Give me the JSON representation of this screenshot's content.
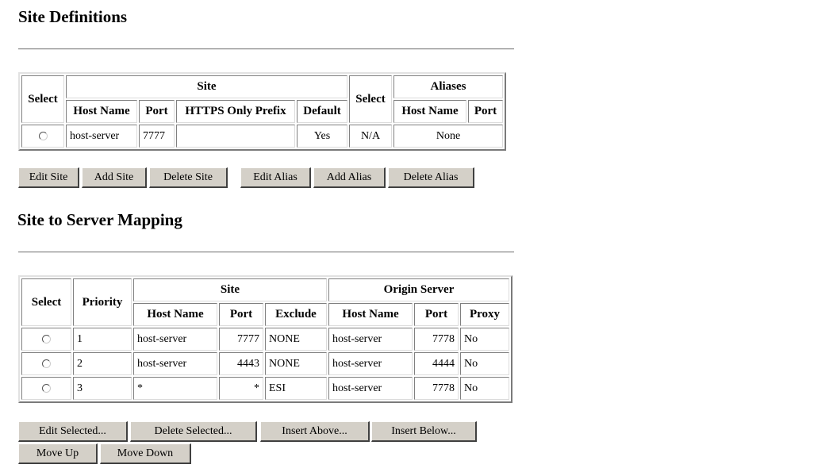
{
  "site_definitions": {
    "title": "Site Definitions",
    "headers": {
      "select": "Select",
      "site": "Site",
      "host_name": "Host Name",
      "port": "Port",
      "https_only_prefix": "HTTPS Only Prefix",
      "default": "Default",
      "select2": "Select",
      "aliases": "Aliases",
      "alias_host_name": "Host Name",
      "alias_port": "Port"
    },
    "rows": [
      {
        "host_name": "host-server",
        "port": "7777",
        "https_only_prefix": "",
        "default": "Yes",
        "alias_select": "N/A",
        "aliases": "None"
      }
    ],
    "buttons": {
      "edit_site": "Edit Site",
      "add_site": "Add Site",
      "delete_site": "Delete Site",
      "edit_alias": "Edit Alias",
      "add_alias": "Add Alias",
      "delete_alias": "Delete Alias"
    }
  },
  "mapping": {
    "title": "Site to Server Mapping",
    "headers": {
      "select": "Select",
      "priority": "Priority",
      "site": "Site",
      "origin_server": "Origin Server",
      "host_name": "Host Name",
      "port": "Port",
      "exclude": "Exclude",
      "origin_host_name": "Host Name",
      "origin_port": "Port",
      "proxy": "Proxy"
    },
    "rows": [
      {
        "priority": "1",
        "host_name": "host-server",
        "port": "7777",
        "exclude": "NONE",
        "origin_host": "host-server",
        "origin_port": "7778",
        "proxy": "No"
      },
      {
        "priority": "2",
        "host_name": "host-server",
        "port": "4443",
        "exclude": "NONE",
        "origin_host": "host-server",
        "origin_port": "4444",
        "proxy": "No"
      },
      {
        "priority": "3",
        "host_name": "*",
        "port": "*",
        "exclude": "ESI",
        "origin_host": "host-server",
        "origin_port": "7778",
        "proxy": "No"
      }
    ],
    "buttons": {
      "edit_selected": "Edit Selected...",
      "delete_selected": "Delete Selected...",
      "insert_above": "Insert Above...",
      "insert_below": "Insert Below...",
      "move_up": "Move Up",
      "move_down": "Move Down"
    }
  }
}
